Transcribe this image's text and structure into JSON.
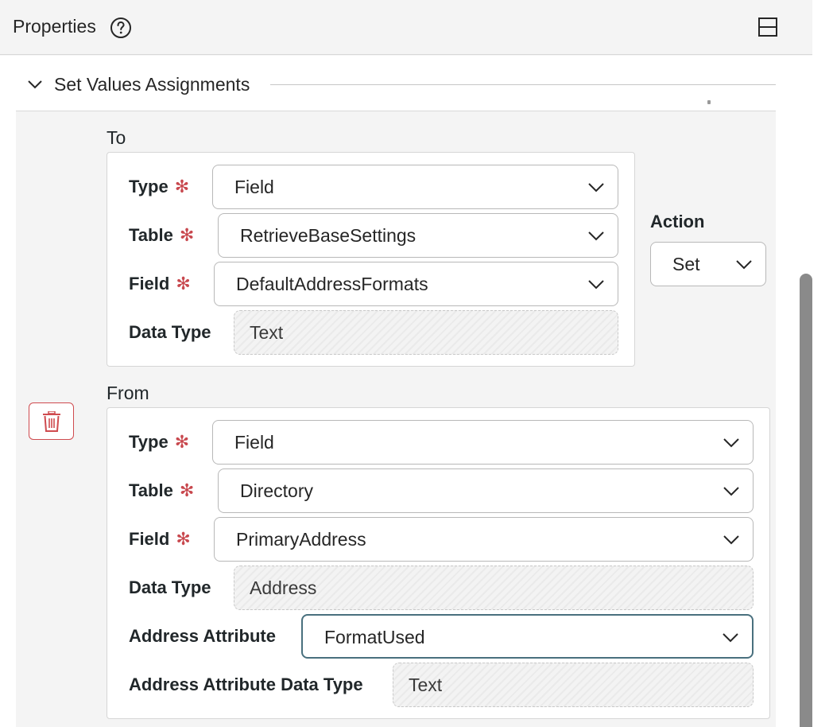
{
  "header": {
    "title": "Properties",
    "help_icon": "help-circle-icon",
    "panel_icon": "panel-layout-icon"
  },
  "section": {
    "title": "Set Values Assignments",
    "expanded": true
  },
  "to": {
    "label": "To",
    "type": {
      "label": "Type",
      "value": "Field",
      "required": "✻"
    },
    "table": {
      "label": "Table",
      "value": "RetrieveBaseSettings",
      "required": "✻"
    },
    "field": {
      "label": "Field",
      "value": "DefaultAddressFormats",
      "required": "✻"
    },
    "data_type": {
      "label": "Data Type",
      "value": "Text"
    }
  },
  "action": {
    "label": "Action",
    "value": "Set"
  },
  "from": {
    "label": "From",
    "type": {
      "label": "Type",
      "value": "Field",
      "required": "✻"
    },
    "table": {
      "label": "Table",
      "value": "Directory",
      "required": "✻"
    },
    "field": {
      "label": "Field",
      "value": "PrimaryAddress",
      "required": "✻"
    },
    "data_type": {
      "label": "Data Type",
      "value": "Address"
    },
    "address_attribute": {
      "label": "Address Attribute",
      "value": "FormatUsed"
    },
    "address_attribute_data_type": {
      "label": "Address Attribute Data Type",
      "value": "Text"
    }
  },
  "delete": {
    "icon": "trash-icon"
  },
  "colors": {
    "required": "#c8484e",
    "delete": "#cf4b4f",
    "focus": "#49707e"
  }
}
